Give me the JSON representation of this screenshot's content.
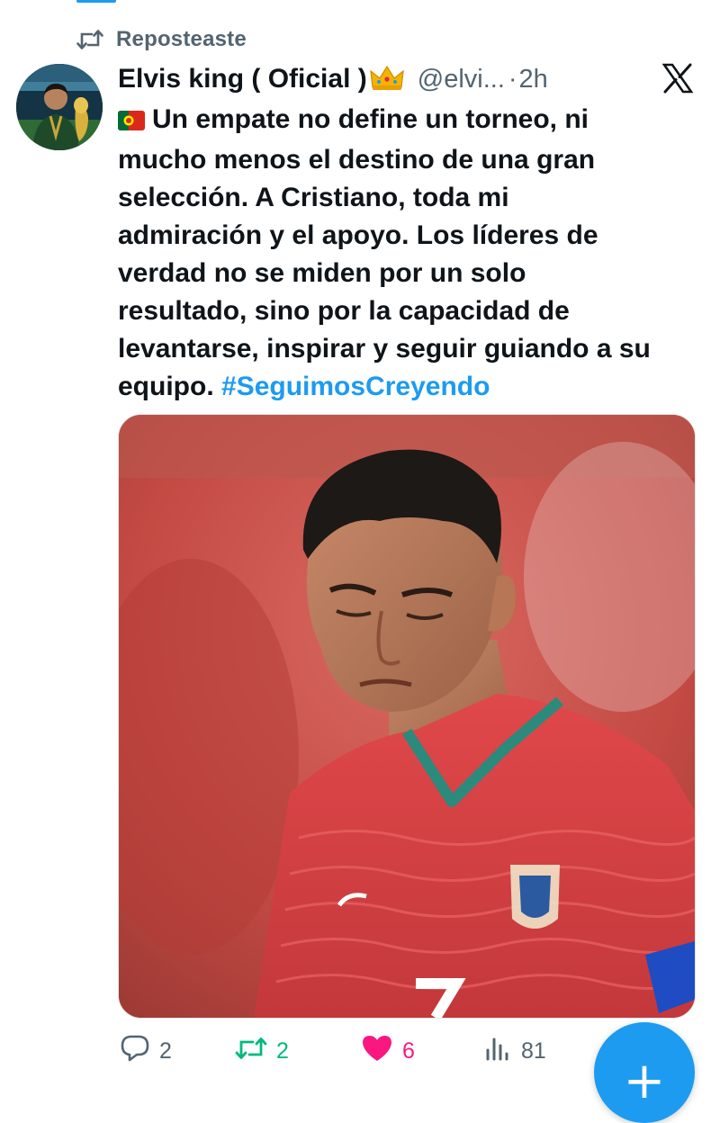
{
  "repost": {
    "label": "Reposteaste",
    "icon": "repost-icon"
  },
  "author": {
    "name": "Elvis king ( Oficial )",
    "badge_emoji": "crown-icon",
    "handle": "@elvi...",
    "separator": "·",
    "time": "2h"
  },
  "header_icons": {
    "platform": "x-logo-icon"
  },
  "tweet": {
    "flag": "portugal-flag-icon",
    "lines": [
      "Un empate no define un torneo, ni",
      "mucho menos el destino de una gran",
      "selección. A Cristiano, toda mi",
      "admiración y el apoyo. Los líderes de",
      "verdad no se miden por un solo",
      "resultado, sino por la capacidad de",
      "levantarse, inspirar y seguir guiando a su",
      "equipo."
    ],
    "hashtag": "#SeguimosCreyendo"
  },
  "media": {
    "kind": "photo",
    "subject": "football-player-photo"
  },
  "actions": {
    "reply_count": "2",
    "retweet_count": "2",
    "like_count": "6",
    "views_count": "81"
  },
  "fab": {
    "label": "+"
  },
  "colors": {
    "accent": "#1d9bf0",
    "retweet_active": "#00ba7c",
    "like_active": "#f91880",
    "secondary_text": "#536471"
  }
}
